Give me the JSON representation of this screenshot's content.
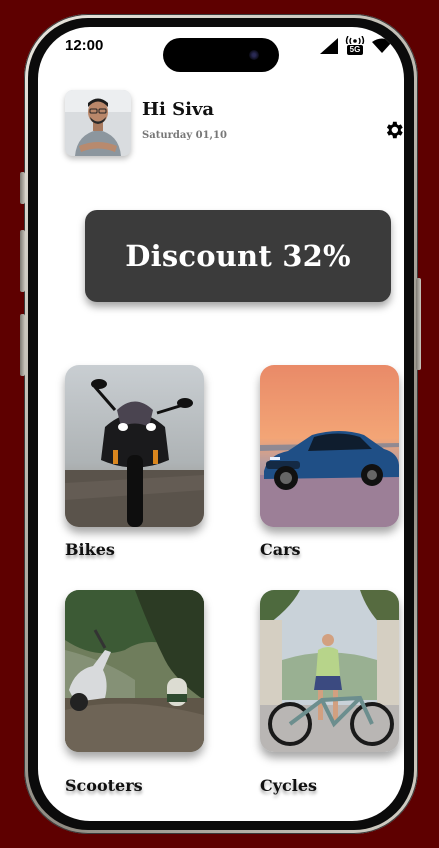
{
  "status_bar": {
    "time": "12:00",
    "icons": [
      "cellular-signal-icon",
      "5g-network-icon",
      "wifi-icon"
    ],
    "network_label": "5G"
  },
  "header": {
    "greeting": "Hi Siva",
    "date": "Saturday 01,10",
    "settings_icon": "gear-icon"
  },
  "promo": {
    "text": "Discount 32%"
  },
  "categories": [
    {
      "label": "Bikes",
      "image": "motorcycle-photo"
    },
    {
      "label": "Cars",
      "image": "blue-car-photo"
    },
    {
      "label": "Scooters",
      "image": "scooter-photo"
    },
    {
      "label": "Cycles",
      "image": "bicycle-photo"
    }
  ],
  "colors": {
    "background": "#5e0000",
    "screen": "#ffffff",
    "promo_bg": "#3b3b3b",
    "promo_text": "#ffffff"
  }
}
